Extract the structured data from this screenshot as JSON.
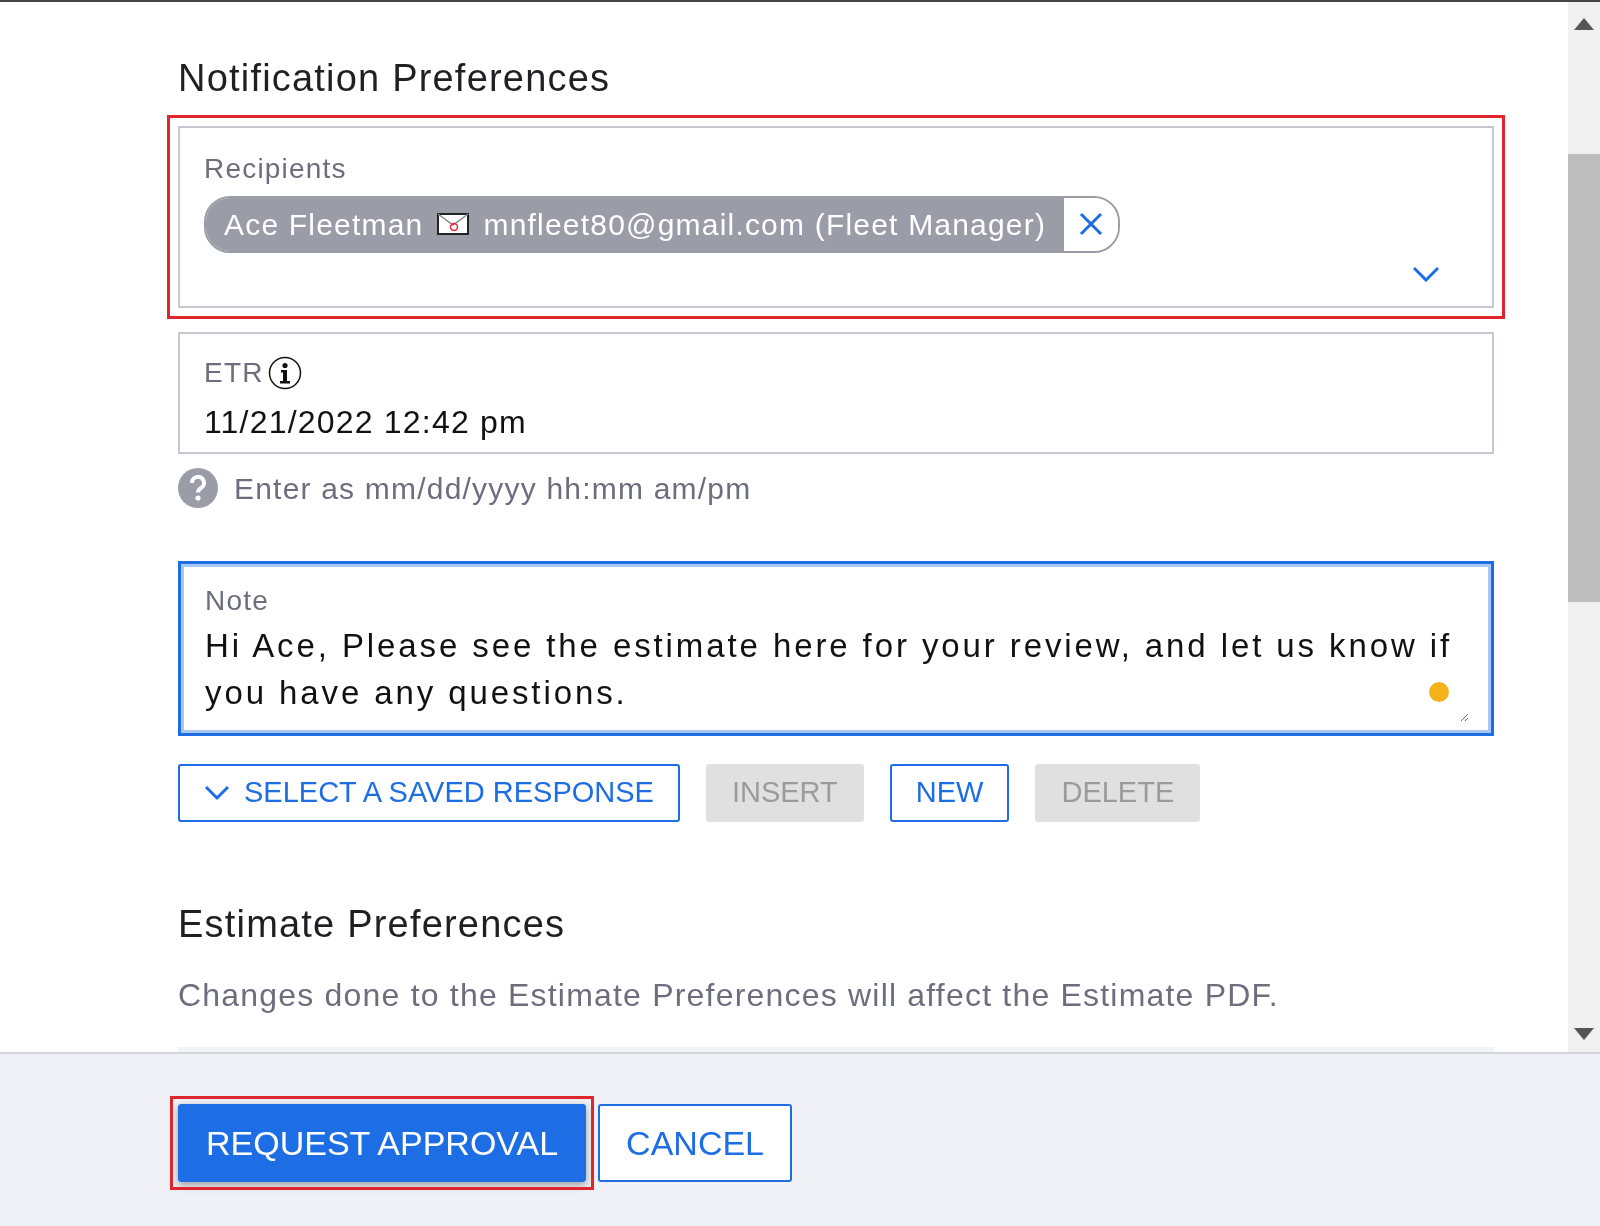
{
  "notification": {
    "heading": "Notification Preferences",
    "recipients": {
      "label": "Recipients",
      "highlighted": true,
      "chips": [
        {
          "name": "Ace Fleetman",
          "email": "mnfleet80@gmail.com (Fleet Manager)"
        }
      ]
    },
    "etr": {
      "label": "ETR",
      "value": "11/21/2022 12:42 pm",
      "hint": "Enter as mm/dd/yyyy hh:mm am/pm"
    },
    "note": {
      "label": "Note",
      "value": "Hi Ace, Please see the estimate here for your review, and let us know if you have any questions.",
      "focused": true
    },
    "buttons": [
      {
        "label": "SELECT A SAVED RESPONSE",
        "kind": "dropdown",
        "disabled": false
      },
      {
        "label": "INSERT",
        "kind": "plain",
        "disabled": true
      },
      {
        "label": "NEW",
        "kind": "plain",
        "disabled": false
      },
      {
        "label": "DELETE",
        "kind": "plain",
        "disabled": true
      }
    ]
  },
  "estimate": {
    "heading": "Estimate Preferences",
    "description": "Changes done to the Estimate Preferences will affect the Estimate PDF."
  },
  "footer": {
    "buttons": [
      {
        "label": "REQUEST APPROVAL",
        "kind": "primary",
        "highlighted": true
      },
      {
        "label": "CANCEL",
        "kind": "outline",
        "highlighted": false
      }
    ]
  }
}
